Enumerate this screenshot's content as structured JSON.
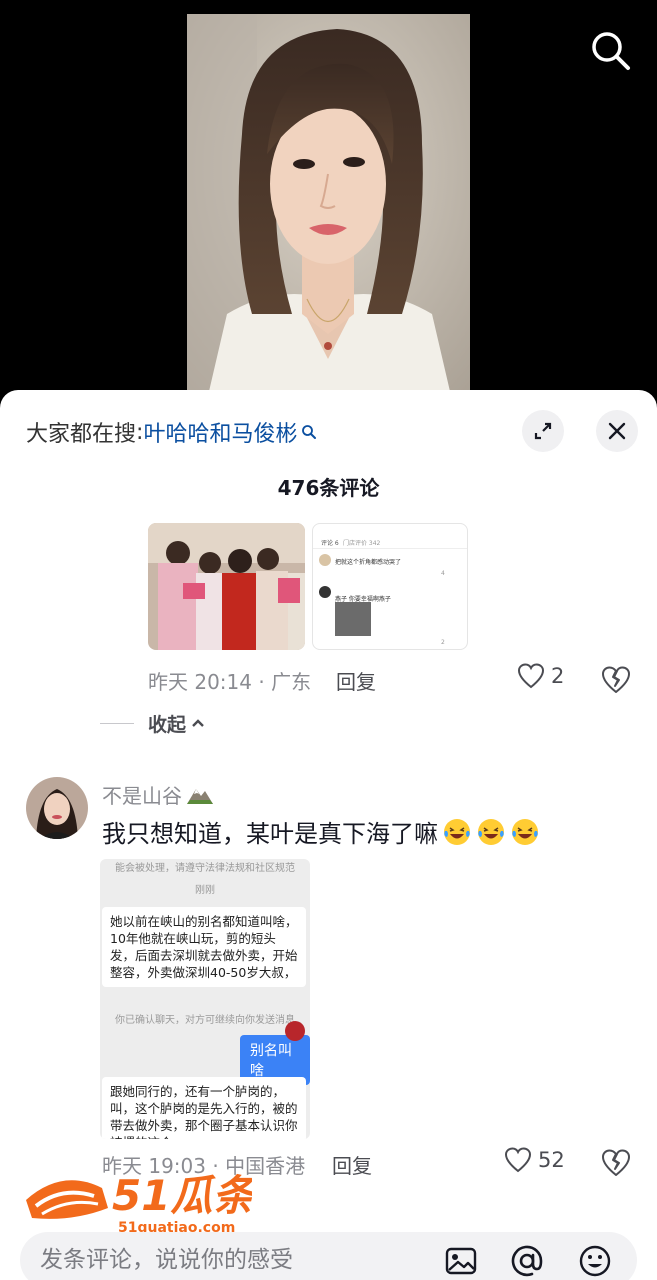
{
  "top": {
    "search_icon": "search-icon"
  },
  "sheet": {
    "hot_search_prefix": "大家都在搜",
    "hot_search_colon": ":",
    "hot_search_term": "叶哈哈和马俊彬",
    "comment_count": "476条评论"
  },
  "reply_comment": {
    "image2_texts": [
      "评论 6",
      "门店评价 342",
      "把就这个折角都感动哭了",
      "燕子 你要幸福啊燕子",
      "4",
      "6",
      "2"
    ],
    "time_location": "昨天 20:14 · 广东",
    "reply_label": "回复",
    "likes": "2"
  },
  "collapse_label": "收起",
  "main_comment": {
    "username": "不是山谷",
    "text": "我只想知道，某叶是真下海了嘛",
    "chat_lines": {
      "top_notice": "能会被处理，请遵守法律法规和社区规范",
      "time": "刚刚",
      "msg1": "她以前在峡山的别名都知道叫啥，10年他就在峡山玩，剪的短头发，后面去深圳就去做外卖，开始整容，外卖做深圳40-50岁大叔，",
      "notice2": "你已确认聊天，对方可继续向你发送消息",
      "msg_right": "别名叫啥",
      "msg2": "跟她同行的，还有一个胪岗的，叫，这个胪岗的是先入行的，被的带去做外卖，那个圈子基本认识你被撂的这个"
    },
    "time_location": "昨天 19:03 · 中国香港",
    "reply_label": "回复",
    "likes": "52"
  },
  "watermark": {
    "brand": "51瓜条",
    "url": "51guatiao.com"
  },
  "input": {
    "placeholder": "发条评论，说说你的感受"
  }
}
